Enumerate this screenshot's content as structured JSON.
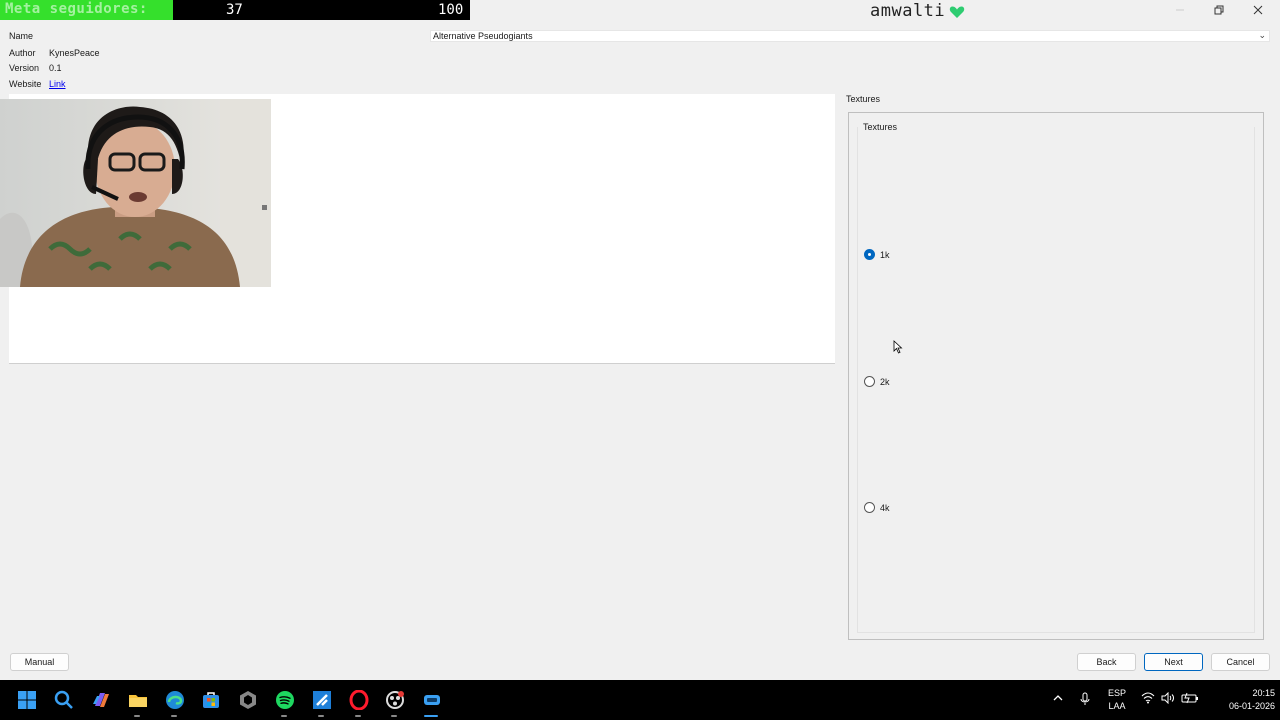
{
  "overlay": {
    "goal_label": "Meta seguidores:",
    "goal_current": "37",
    "goal_target": "100",
    "goal_progress": 0.37,
    "fill_color": "#35e02c"
  },
  "window": {
    "title": "amwalti",
    "heart_color": "#2ecc71",
    "minimize_icon": "minimize-icon",
    "restore_icon": "restore-icon",
    "close_icon": "close-icon"
  },
  "info": {
    "name_label": "Name",
    "name_value": "Alternative Pseudogiants",
    "author_label": "Author",
    "author_value": "KynesPeace",
    "version_label": "Version",
    "version_value": "0.1",
    "website_label": "Website",
    "website_value": "Link"
  },
  "textures": {
    "panel_title": "Textures",
    "group_title": "Textures",
    "options": [
      {
        "label": "1k",
        "checked": true
      },
      {
        "label": "2k",
        "checked": false
      },
      {
        "label": "4k",
        "checked": false
      }
    ]
  },
  "buttons": {
    "manual": "Manual",
    "back": "Back",
    "next": "Next",
    "cancel": "Cancel"
  },
  "taskbar": {
    "apps": [
      "windows-start-icon",
      "search-icon",
      "copilot-icon",
      "file-explorer-icon",
      "edge-icon",
      "store-icon",
      "unity-icon",
      "spotify-icon",
      "visual-studio-icon",
      "opera-icon",
      "obs-icon",
      "app-icon"
    ],
    "lang_top": "ESP",
    "lang_bottom": "LAA",
    "time": "20:15",
    "date": "06-01-2026"
  }
}
